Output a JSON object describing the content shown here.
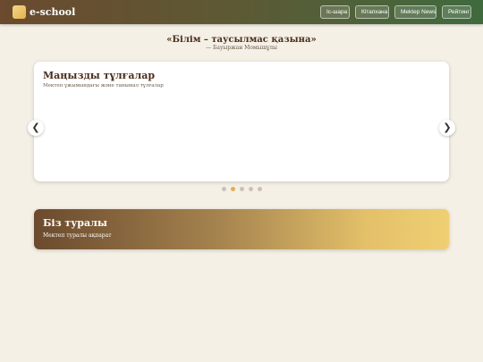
{
  "header": {
    "brand": "e-school",
    "logo_icon": "school-logo-icon",
    "nav": [
      {
        "label": "Іс-шара"
      },
      {
        "label": "Кітапхана"
      },
      {
        "label": "Mektep News"
      },
      {
        "label": "Рейтинг"
      }
    ]
  },
  "quote": {
    "text": "«Білім – таусылмас қазына»",
    "author": "— Бауыржан Момышұлы"
  },
  "carousel": {
    "title": "Маңызды тұлғалар",
    "subtitle": "Мектеп ұжымындағы және танымал тұлғалар",
    "prev_arrow": "❮",
    "next_arrow": "❯",
    "dots_count": 5,
    "active_dot": 2
  },
  "about": {
    "title": "Біз туралы",
    "subtitle": "Мектеп туралы ақпарат"
  },
  "colors": {
    "accent": "#e3b04b",
    "brown": "#6b4a2e",
    "green": "#3f6a3e",
    "background": "#f5f0e6"
  }
}
